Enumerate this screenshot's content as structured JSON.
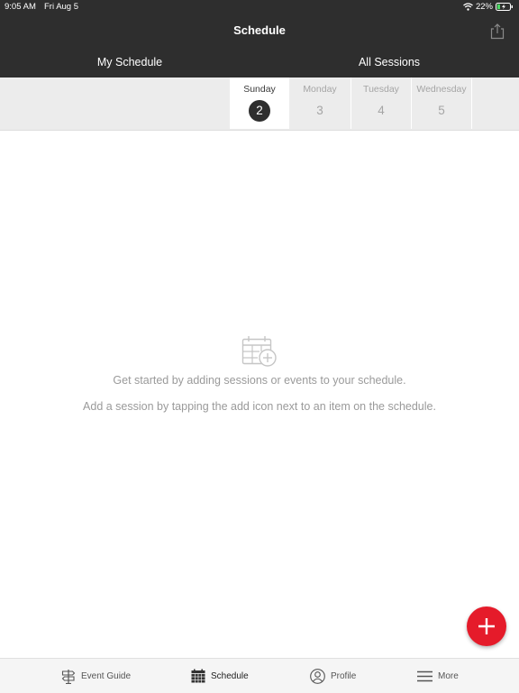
{
  "status_bar": {
    "time": "9:05 AM",
    "date": "Fri Aug 5",
    "battery": "22%"
  },
  "header": {
    "title": "Schedule",
    "share_icon": "share-icon"
  },
  "tabs": [
    {
      "label": "My Schedule",
      "selected": true
    },
    {
      "label": "All Sessions",
      "selected": false
    }
  ],
  "days": [
    {
      "name": "Sunday",
      "number": "2",
      "selected": true
    },
    {
      "name": "Monday",
      "number": "3",
      "selected": false
    },
    {
      "name": "Tuesday",
      "number": "4",
      "selected": false
    },
    {
      "name": "Wednesday",
      "number": "5",
      "selected": false
    }
  ],
  "empty_state": {
    "icon": "calendar-add-icon",
    "line1": "Get started by adding sessions or events to your schedule.",
    "line2": "Add a session by tapping the add icon next to an item on the schedule."
  },
  "fab": {
    "icon": "plus-icon"
  },
  "tab_bar": [
    {
      "label": "Event Guide",
      "icon": "signpost-icon",
      "selected": false
    },
    {
      "label": "Schedule",
      "icon": "calendar-icon",
      "selected": true
    },
    {
      "label": "Profile",
      "icon": "person-icon",
      "selected": false
    },
    {
      "label": "More",
      "icon": "menu-icon",
      "selected": false
    }
  ],
  "colors": {
    "header_bg": "#2e2e2e",
    "accent": "#e51b2a",
    "muted_text": "#9a9a9a"
  }
}
